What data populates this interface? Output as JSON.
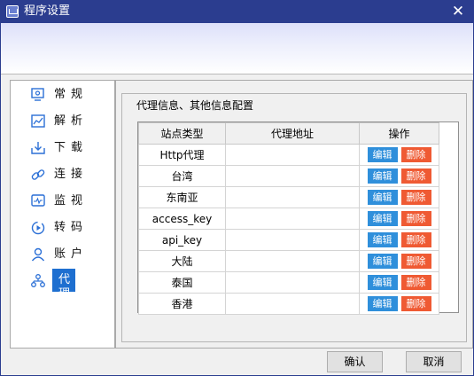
{
  "window": {
    "title": "程序设置",
    "close_symbol": "✕"
  },
  "nav": {
    "items": [
      {
        "label": "常规",
        "icon": "monitor-gear-icon"
      },
      {
        "label": "解析",
        "icon": "chart-icon"
      },
      {
        "label": "下载",
        "icon": "download-icon"
      },
      {
        "label": "连接",
        "icon": "link-icon"
      },
      {
        "label": "监视",
        "icon": "monitor-icon"
      },
      {
        "label": "转码",
        "icon": "transcode-icon"
      },
      {
        "label": "账户",
        "icon": "user-icon"
      },
      {
        "label": "代理",
        "icon": "network-icon",
        "active": true
      }
    ]
  },
  "panel": {
    "group_title": "代理信息、其他信息配置",
    "table": {
      "headers": [
        "站点类型",
        "代理地址",
        "操作"
      ],
      "rows": [
        {
          "site": "Http代理",
          "proxy": ""
        },
        {
          "site": "台湾",
          "proxy": ""
        },
        {
          "site": "东南亚",
          "proxy": ""
        },
        {
          "site": "access_key",
          "proxy": ""
        },
        {
          "site": "api_key",
          "proxy": ""
        },
        {
          "site": "大陆",
          "proxy": ""
        },
        {
          "site": "泰国",
          "proxy": ""
        },
        {
          "site": "香港",
          "proxy": ""
        }
      ],
      "edit_label": "编辑",
      "delete_label": "删除"
    }
  },
  "footer": {
    "ok_label": "确认",
    "cancel_label": "取消"
  },
  "colors": {
    "titlebar": "#2b3d8f",
    "accent": "#1e6fd0",
    "edit": "#2f8fdb",
    "delete": "#ef5a33"
  }
}
